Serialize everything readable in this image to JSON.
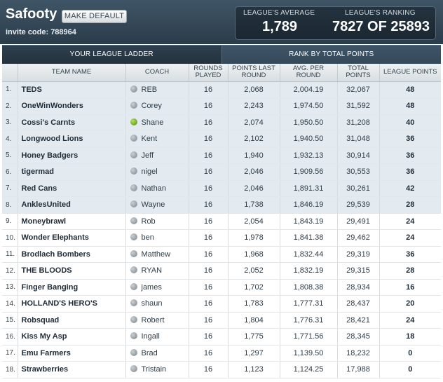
{
  "header": {
    "league_name": "Safooty",
    "make_default_label": "MAKE DEFAULT",
    "invite_label": "invite code:",
    "invite_code": "788964",
    "league_average_label": "LEAGUE'S AVERAGE",
    "league_average_value": "1,789",
    "league_ranking_label": "LEAGUE'S RANKING",
    "league_ranking_value": "7827 OF 25893"
  },
  "tabs": [
    {
      "label": "YOUR LEAGUE LADDER",
      "active": true
    },
    {
      "label": "RANK BY TOTAL POINTS",
      "active": false
    }
  ],
  "columns": {
    "team": "TEAM NAME",
    "coach": "COACH",
    "rounds_played": "ROUNDS PLAYED",
    "points_last_round": "POINTS LAST ROUND",
    "avg_per_round": "AVG. PER ROUND",
    "total_points": "TOTAL POINTS",
    "league_points": "LEAGUE POINTS"
  },
  "rows": [
    {
      "rank": "1.",
      "team": "TEDS",
      "coach": "REB",
      "online": false,
      "rounds": "16",
      "last": "2,068",
      "avg": "2,004.19",
      "total": "32,067",
      "league_pts": "48"
    },
    {
      "rank": "2.",
      "team": "OneWinWonders",
      "coach": "Corey",
      "online": false,
      "rounds": "16",
      "last": "2,243",
      "avg": "1,974.50",
      "total": "31,592",
      "league_pts": "48"
    },
    {
      "rank": "3.",
      "team": "Cossi's Carnts",
      "coach": "Shane",
      "online": true,
      "rounds": "16",
      "last": "2,074",
      "avg": "1,950.50",
      "total": "31,208",
      "league_pts": "40"
    },
    {
      "rank": "4.",
      "team": "Longwood Lions",
      "coach": "Kent",
      "online": false,
      "rounds": "16",
      "last": "2,102",
      "avg": "1,940.50",
      "total": "31,048",
      "league_pts": "36"
    },
    {
      "rank": "5.",
      "team": "Honey Badgers",
      "coach": "Jeff",
      "online": false,
      "rounds": "16",
      "last": "1,940",
      "avg": "1,932.13",
      "total": "30,914",
      "league_pts": "36"
    },
    {
      "rank": "6.",
      "team": "tigermad",
      "coach": "nigel",
      "online": false,
      "rounds": "16",
      "last": "2,046",
      "avg": "1,909.56",
      "total": "30,553",
      "league_pts": "36"
    },
    {
      "rank": "7.",
      "team": "Red Cans",
      "coach": "Nathan",
      "online": false,
      "rounds": "16",
      "last": "2,046",
      "avg": "1,891.31",
      "total": "30,261",
      "league_pts": "42"
    },
    {
      "rank": "8.",
      "team": "AnklesUnited",
      "coach": "Wayne",
      "online": false,
      "rounds": "16",
      "last": "1,738",
      "avg": "1,846.19",
      "total": "29,539",
      "league_pts": "28"
    },
    {
      "rank": "9.",
      "team": "Moneybrawl",
      "coach": "Rob",
      "online": false,
      "rounds": "16",
      "last": "2,054",
      "avg": "1,843.19",
      "total": "29,491",
      "league_pts": "24"
    },
    {
      "rank": "10.",
      "team": "Wonder Elephants",
      "coach": "ben",
      "online": false,
      "rounds": "16",
      "last": "1,978",
      "avg": "1,841.38",
      "total": "29,462",
      "league_pts": "24"
    },
    {
      "rank": "11.",
      "team": "Brodlach Bombers",
      "coach": "Matthew",
      "online": false,
      "rounds": "16",
      "last": "1,968",
      "avg": "1,832.44",
      "total": "29,319",
      "league_pts": "36"
    },
    {
      "rank": "12.",
      "team": "THE BLOODS",
      "coach": "RYAN",
      "online": false,
      "rounds": "16",
      "last": "2,052",
      "avg": "1,832.19",
      "total": "29,315",
      "league_pts": "28"
    },
    {
      "rank": "13.",
      "team": "Finger Banging",
      "coach": "james",
      "online": false,
      "rounds": "16",
      "last": "1,702",
      "avg": "1,808.38",
      "total": "28,934",
      "league_pts": "16"
    },
    {
      "rank": "14.",
      "team": "HOLLAND'S HERO'S",
      "coach": "shaun",
      "online": false,
      "rounds": "16",
      "last": "1,783",
      "avg": "1,777.31",
      "total": "28,437",
      "league_pts": "20"
    },
    {
      "rank": "15.",
      "team": "Robsquad",
      "coach": "Robert",
      "online": false,
      "rounds": "16",
      "last": "1,804",
      "avg": "1,776.31",
      "total": "28,421",
      "league_pts": "24"
    },
    {
      "rank": "16.",
      "team": "Kiss My Asp",
      "coach": "Ingall",
      "online": false,
      "rounds": "16",
      "last": "1,775",
      "avg": "1,771.56",
      "total": "28,345",
      "league_pts": "18"
    },
    {
      "rank": "17.",
      "team": "Emu Farmers",
      "coach": "Brad",
      "online": false,
      "rounds": "16",
      "last": "1,297",
      "avg": "1,139.50",
      "total": "18,232",
      "league_pts": "0"
    },
    {
      "rank": "18.",
      "team": "Strawberries",
      "coach": "Tristain",
      "online": false,
      "rounds": "16",
      "last": "1,123",
      "avg": "1,124.25",
      "total": "17,988",
      "league_pts": "0"
    }
  ],
  "top_section_count": 8
}
